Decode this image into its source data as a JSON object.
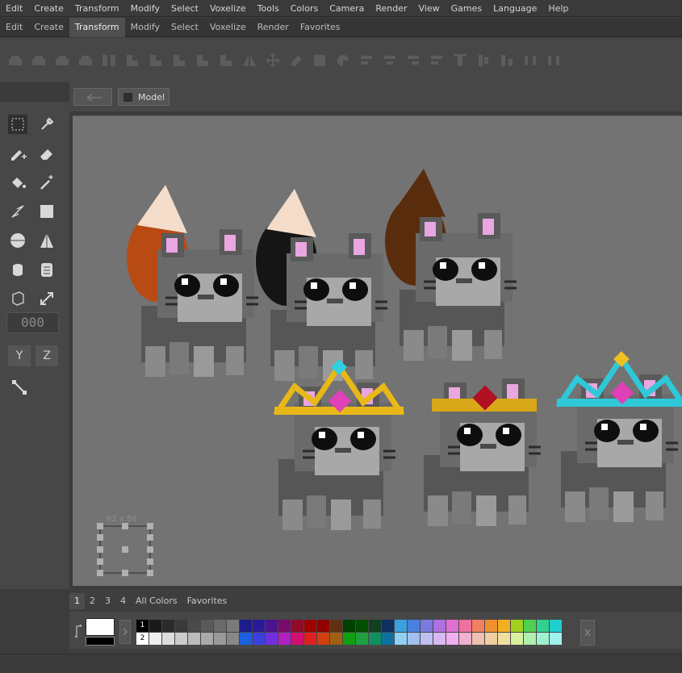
{
  "menubar": [
    "Edit",
    "Create",
    "Transform",
    "Modify",
    "Select",
    "Voxelize",
    "Tools",
    "Colors",
    "Camera",
    "Render",
    "View",
    "Games",
    "Language",
    "Help"
  ],
  "tabs": [
    {
      "label": "Edit",
      "active": false
    },
    {
      "label": "Create",
      "active": false
    },
    {
      "label": "Transform",
      "active": true
    },
    {
      "label": "Modify",
      "active": false
    },
    {
      "label": "Select",
      "active": false
    },
    {
      "label": "Voxelize",
      "active": false
    },
    {
      "label": "Render",
      "active": false
    },
    {
      "label": "Favorites",
      "active": false
    }
  ],
  "toolbar_icons": [
    "resize-icon",
    "resize-icon",
    "resize-icon",
    "resize-icon",
    "flip-horizontal-icon",
    "rotate-icon",
    "rotate-icon",
    "rotate-icon",
    "rotate-icon",
    "rotate-icon",
    "mirror-icon",
    "move-icon",
    "skew-icon",
    "fill-box-icon",
    "bend-icon",
    "align-left-icon",
    "align-center-icon",
    "align-right-icon",
    "align-left-icon",
    "align-top-icon",
    "align-middle-icon",
    "align-bottom-icon",
    "distribute-icon",
    "distribute-icon"
  ],
  "left_tools": [
    "select-rect-icon",
    "eyedropper-icon",
    "pencil-add-icon",
    "eraser-icon",
    "paint-bucket-icon",
    "magic-wand-icon",
    "line-icon",
    "rectangle-icon",
    "sphere-icon",
    "cone-icon",
    "cylinder-icon",
    "stack-icon",
    "cube-icon",
    "scale-arrows-icon"
  ],
  "numeric_display": "000",
  "axis_buttons": [
    "Y",
    "Z"
  ],
  "view_header": {
    "back_icon": "arrow-left-icon",
    "model_label": "Model"
  },
  "canvas": {
    "size_label": "62 x 56"
  },
  "palette": {
    "tabs": [
      {
        "label": "1",
        "active": true
      },
      {
        "label": "2",
        "active": false
      },
      {
        "label": "3",
        "active": false
      },
      {
        "label": "4",
        "active": false
      },
      {
        "label": "All Colors",
        "active": false
      },
      {
        "label": "Favorites",
        "active": false
      }
    ],
    "row_labels": [
      "1",
      "2"
    ],
    "foreground": "#ffffff",
    "background": "#000000",
    "row1": [
      "#000000",
      "#1a1a1a",
      "#2b2b2b",
      "#3a3a3a",
      "#4a4a4a",
      "#5a5a5a",
      "#6a6a6a",
      "#7a7a7a",
      "#1c1c8c",
      "#2a1a9a",
      "#4a1490",
      "#7a0a6a",
      "#900a2a",
      "#a00000",
      "#900000",
      "#603010",
      "#004000",
      "#005000",
      "#104020",
      "#103060",
      "#3aa0e0",
      "#4a80e0",
      "#7a7ae0",
      "#b070e0",
      "#e070d0",
      "#f070a0",
      "#f08060",
      "#f09030",
      "#f0b020",
      "#a0d020",
      "#50d050",
      "#30d090",
      "#20d0d0"
    ],
    "row2": [
      "#ffffff",
      "#eeeeee",
      "#dddddd",
      "#cccccc",
      "#bbbbbb",
      "#aaaaaa",
      "#999999",
      "#888888",
      "#1a60e0",
      "#3a40e0",
      "#7030e0",
      "#b020c0",
      "#d01070",
      "#e02020",
      "#d04010",
      "#a06010",
      "#10a010",
      "#20a040",
      "#109060",
      "#1070a0",
      "#90d0f0",
      "#a0c0f0",
      "#c0c0f0",
      "#d8b8f0",
      "#f0b0f0",
      "#f0b0d0",
      "#f0c0b0",
      "#f0d0a0",
      "#f0e0a0",
      "#d8f0a0",
      "#b0f0b0",
      "#a0f0d0",
      "#a0f0f0"
    ]
  },
  "scene": {
    "characters": [
      {
        "type": "cat",
        "accessory": "orange-cream-tail"
      },
      {
        "type": "cat",
        "accessory": "black-cream-tail"
      },
      {
        "type": "cat",
        "accessory": "brown-tail"
      },
      {
        "type": "cat",
        "accessory": "gold-crown"
      },
      {
        "type": "cat",
        "accessory": "gold-band-ruby"
      },
      {
        "type": "cat",
        "accessory": "cyan-crown"
      }
    ]
  }
}
